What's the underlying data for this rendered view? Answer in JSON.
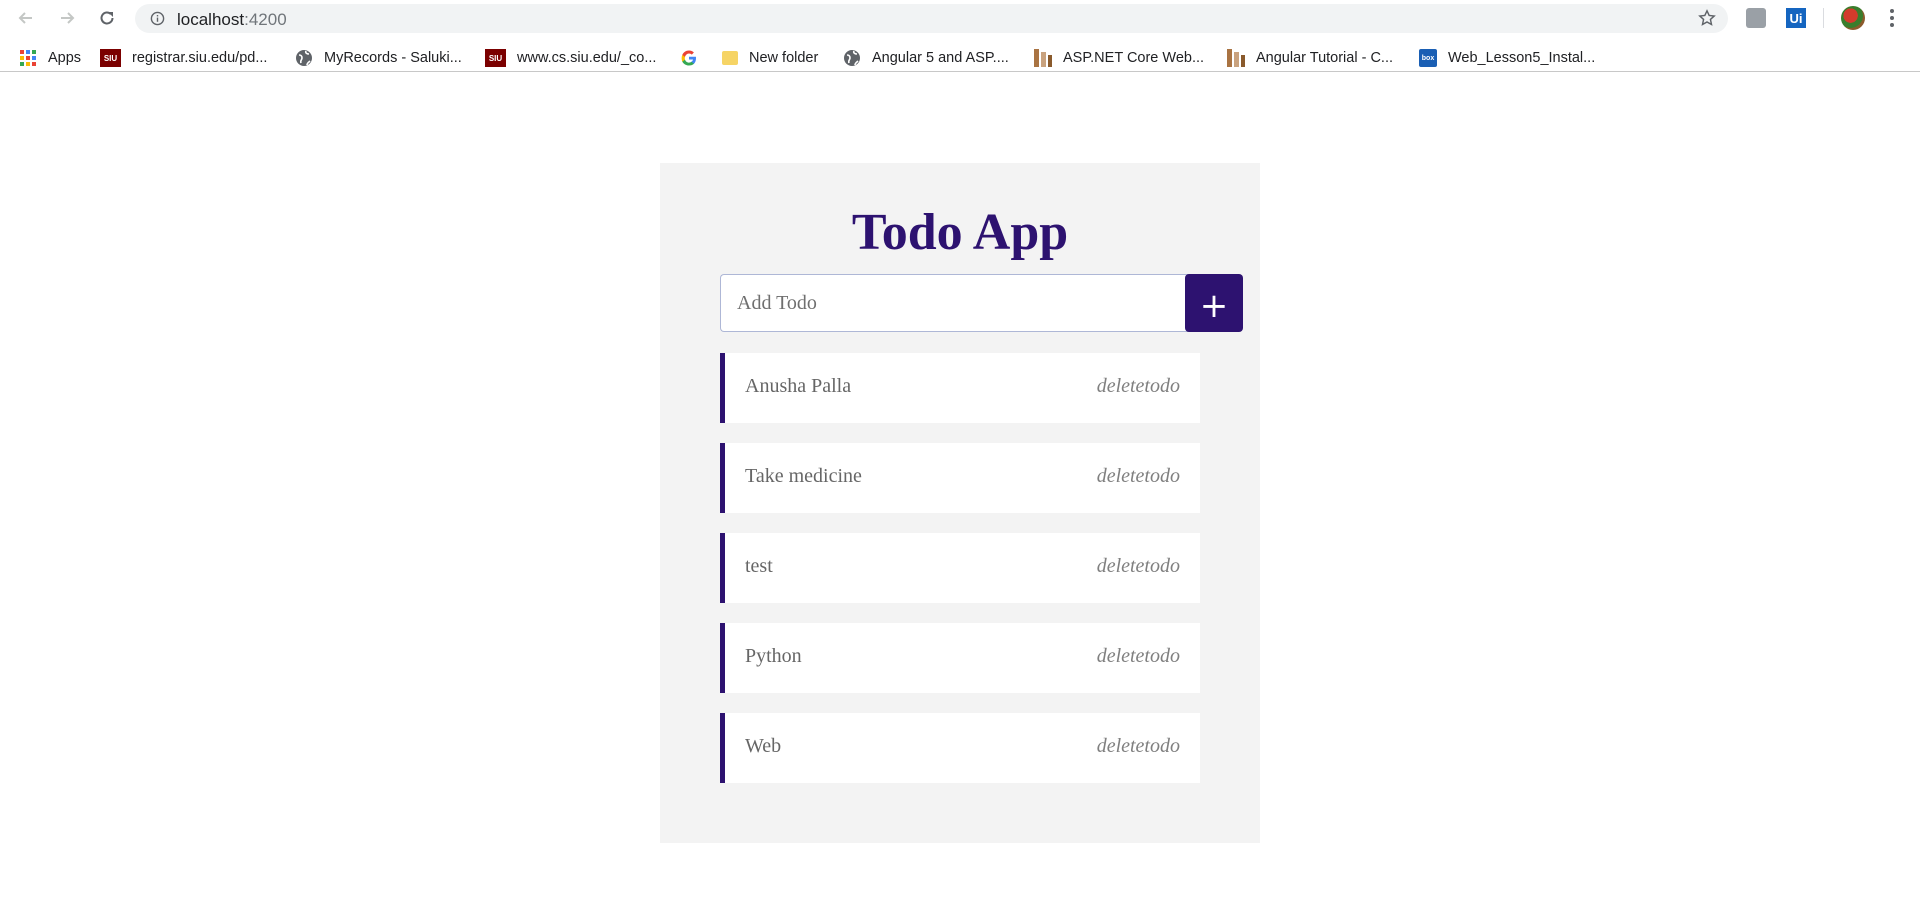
{
  "browser": {
    "url_host": "localhost",
    "url_port": ":4200",
    "bookmarks": [
      {
        "label": "Apps",
        "icon": "apps-grid-icon"
      },
      {
        "label": "registrar.siu.edu/pd...",
        "icon": "siu-icon"
      },
      {
        "label": "MyRecords - Saluki...",
        "icon": "globe-icon"
      },
      {
        "label": "www.cs.siu.edu/_co...",
        "icon": "siu-icon"
      },
      {
        "label": "",
        "icon": "google-icon"
      },
      {
        "label": "New folder",
        "icon": "folder-icon"
      },
      {
        "label": "Angular 5 and ASP....",
        "icon": "globe-icon"
      },
      {
        "label": "ASP.NET Core Web...",
        "icon": "bookmark-site-icon"
      },
      {
        "label": "Angular Tutorial - C...",
        "icon": "bookmark-site-icon"
      },
      {
        "label": "Web_Lesson5_Instal...",
        "icon": "box-icon"
      }
    ],
    "siu_badge": "SIU",
    "box_badge": "box",
    "ui_ext_label": "Ui"
  },
  "app": {
    "title": "Todo App",
    "input_placeholder": "Add Todo",
    "add_button_label": "+",
    "accent_color": "#2d1270",
    "todos": [
      {
        "text": "Anusha Palla",
        "delete_label": "deletetodo"
      },
      {
        "text": "Take medicine",
        "delete_label": "deletetodo"
      },
      {
        "text": "test",
        "delete_label": "deletetodo"
      },
      {
        "text": "Python",
        "delete_label": "deletetodo"
      },
      {
        "text": "Web",
        "delete_label": "deletetodo"
      }
    ]
  }
}
